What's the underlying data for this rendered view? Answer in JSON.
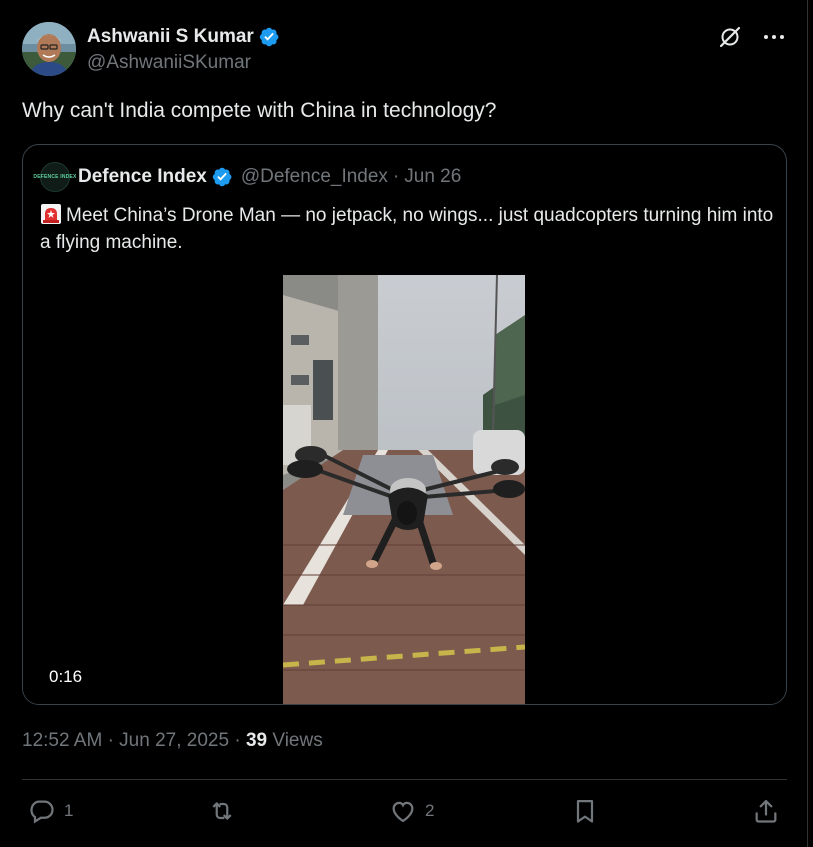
{
  "author": {
    "name": "Ashwanii S Kumar",
    "handle": "@AshwaniiSKumar",
    "verified": true
  },
  "tweet": {
    "text": "Why can't India compete with China in technology?"
  },
  "quoted": {
    "avatar_text": "DEFENCE INDEX",
    "name": "Defence Index",
    "handle": "@Defence_Index",
    "separator": "·",
    "date": "Jun 26",
    "text": "Meet China’s Drone Man — no jetpack, no wings... just quadcopters turning him into a flying machine.",
    "video_duration": "0:16"
  },
  "meta": {
    "time": "12:52 AM",
    "sep1": "·",
    "date": "Jun 27, 2025",
    "sep2": "·",
    "views_count": "39",
    "views_label": "Views"
  },
  "actions": {
    "reply_count": "1",
    "repost_count": "",
    "like_count": "2"
  },
  "colors": {
    "background": "#000000",
    "text": "#e7e9ea",
    "muted": "#71767b",
    "verified": "#1d9bf0",
    "border": "#2f3336"
  }
}
